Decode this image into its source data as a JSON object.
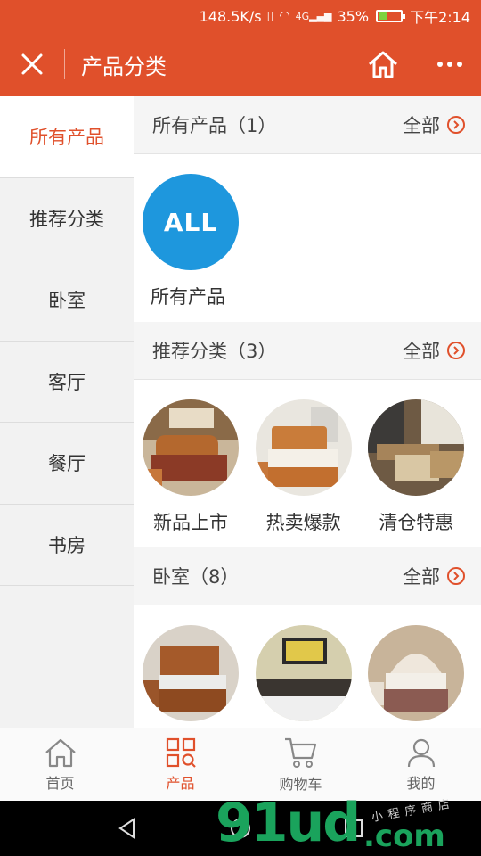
{
  "status_bar": {
    "speed": "148.5K/s",
    "network": "4G",
    "battery": "35%",
    "battery_level": 0.35,
    "time": "下午2:14"
  },
  "header": {
    "title": "产品分类"
  },
  "sidebar": {
    "items": [
      {
        "label": "所有产品",
        "active": true
      },
      {
        "label": "推荐分类",
        "active": false
      },
      {
        "label": "卧室",
        "active": false
      },
      {
        "label": "客厅",
        "active": false
      },
      {
        "label": "餐厅",
        "active": false
      },
      {
        "label": "书房",
        "active": false
      }
    ]
  },
  "sections": [
    {
      "title": "所有产品（1）",
      "all_label": "全部",
      "items": [
        {
          "label": "所有产品",
          "badge": "ALL"
        }
      ]
    },
    {
      "title": "推荐分类（3）",
      "all_label": "全部",
      "items": [
        {
          "label": "新品上市"
        },
        {
          "label": "热卖爆款"
        },
        {
          "label": "清仓特惠"
        }
      ]
    },
    {
      "title": "卧室（8）",
      "all_label": "全部",
      "items": []
    }
  ],
  "tabbar": {
    "tabs": [
      {
        "label": "首页",
        "icon": "home-icon"
      },
      {
        "label": "产品",
        "icon": "grid-search-icon",
        "active": true
      },
      {
        "label": "购物车",
        "icon": "cart-icon"
      },
      {
        "label": "我的",
        "icon": "user-icon"
      }
    ]
  },
  "watermark": {
    "brand": "91ud",
    "suffix": ".com",
    "cn": "小程序商店"
  },
  "colors": {
    "accent": "#e0502b",
    "all_badge": "#1e97dd",
    "watermark": "#1aa35c"
  }
}
